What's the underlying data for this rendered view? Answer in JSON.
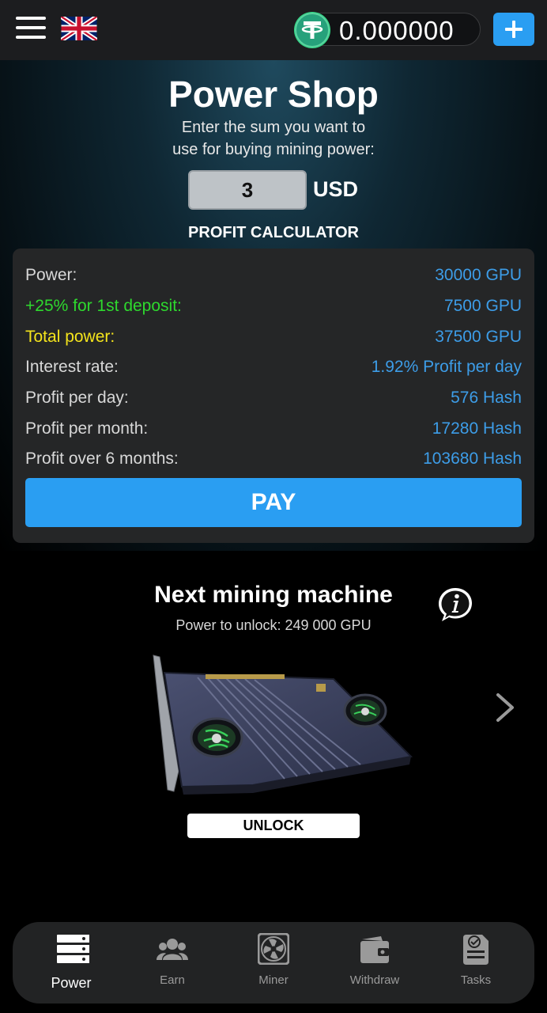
{
  "header": {
    "balance": "0.000000",
    "menu_icon": "hamburger-menu-icon",
    "flag_icon": "uk-flag-icon",
    "currency_icon": "tether-icon",
    "add_icon": "plus-icon"
  },
  "shop": {
    "title": "Power Shop",
    "subtitle_line1": "Enter the sum you want to",
    "subtitle_line2": "use for buying mining power:",
    "amount": "3",
    "currency": "USD",
    "calculator_title": "PROFIT CALCULATOR"
  },
  "calculator": {
    "rows": [
      {
        "label": "Power:",
        "value": "30000 GPU",
        "color": "default"
      },
      {
        "label": "+25% for 1st deposit:",
        "value": "7500 GPU",
        "color": "#2ed82e"
      },
      {
        "label": "Total power:",
        "value": "37500 GPU",
        "color": "#f4e41c"
      },
      {
        "label": "Interest rate:",
        "value": "1.92% Profit per day",
        "color": "default"
      },
      {
        "label": "Profit per day:",
        "value": "576 Hash",
        "color": "default"
      },
      {
        "label": "Profit per month:",
        "value": "17280 Hash",
        "color": "default"
      },
      {
        "label": "Profit over 6 months:",
        "value": "103680 Hash",
        "color": "default"
      }
    ],
    "pay_label": "PAY",
    "accent": "#2a9ef2",
    "value_color": "#3d9de8"
  },
  "machine": {
    "title": "Next mining machine",
    "unlock_requirement": "Power to unlock: 249 000 GPU",
    "unlock_label": "UNLOCK",
    "info_icon": "info-icon",
    "next_icon": "chevron-right-icon"
  },
  "nav": {
    "items": [
      {
        "label": "Power",
        "icon": "server-icon",
        "active": true
      },
      {
        "label": "Earn",
        "icon": "users-icon",
        "active": false
      },
      {
        "label": "Miner",
        "icon": "fan-icon",
        "active": false
      },
      {
        "label": "Withdraw",
        "icon": "wallet-icon",
        "active": false
      },
      {
        "label": "Tasks",
        "icon": "task-document-icon",
        "active": false
      }
    ]
  }
}
